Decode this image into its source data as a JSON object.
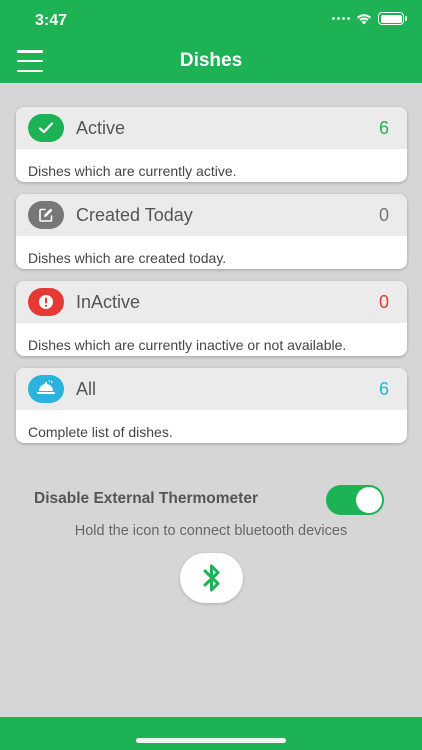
{
  "status_bar": {
    "time": "3:47"
  },
  "header": {
    "title": "Dishes"
  },
  "cards": [
    {
      "title": "Active",
      "count": "6",
      "description": "Dishes which are currently active.",
      "color": "#1db355",
      "icon": "checkmark-icon"
    },
    {
      "title": "Created Today",
      "count": "0",
      "description": "Dishes which are created today.",
      "color": "#777777",
      "icon": "edit-icon"
    },
    {
      "title": "InActive",
      "count": "0",
      "description": "Dishes which are currently inactive or not available.",
      "color": "#e53935",
      "icon": "alert-icon"
    },
    {
      "title": "All",
      "count": "6",
      "description": "Complete list of dishes.",
      "color": "#29b3dd",
      "icon": "dish-icon"
    }
  ],
  "thermometer": {
    "label": "Disable External Thermometer",
    "enabled": true
  },
  "bluetooth": {
    "hint": "Hold the icon to connect bluetooth devices",
    "icon": "bluetooth-icon"
  }
}
